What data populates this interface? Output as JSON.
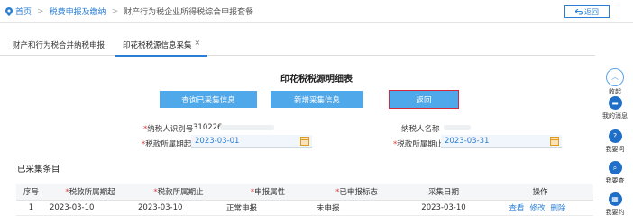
{
  "breadcrumb": {
    "home": "首页",
    "level2": "税费申报及缴纳",
    "current": "财产行为税企业所得税综合申报套餐"
  },
  "header": {
    "back_label": "返回"
  },
  "tabs": [
    {
      "label": "财产和行为税合并纳税申报"
    },
    {
      "label": "印花税税源信息采集",
      "close": "×"
    }
  ],
  "form": {
    "title": "印花税税源明细表",
    "buttons": {
      "query": "查询已采集信息",
      "add": "新增采集信息",
      "return": "返回"
    },
    "taxpayer_id_label": "纳税人识别号",
    "taxpayer_id_value": "310226",
    "taxpayer_name_label": "纳税人名称",
    "period_start_label": "税款所属期起",
    "period_start_value": "2023-03-01",
    "period_end_label": "税款所属期止",
    "period_end_value": "2023-03-31",
    "required_mark": "*"
  },
  "collected": {
    "title": "已采集条目",
    "columns": [
      "序号",
      "*税款所属期起",
      "*税款所属期止",
      "*申报属性",
      "*已申报标志",
      "采集日期",
      "操作"
    ],
    "rows": [
      {
        "index": "1",
        "start": "2023-03-10",
        "end": "2023-03-10",
        "attribute": "正常申报",
        "flag": "未申报",
        "date": "2023-03-10",
        "ops": [
          "查看",
          "修改",
          "删除"
        ]
      }
    ]
  },
  "sidebar": {
    "collapse": "收起",
    "items": [
      {
        "label": "我的消息",
        "icon": "message-icon"
      },
      {
        "label": "我要问",
        "icon": "question-icon"
      },
      {
        "label": "我要查",
        "icon": "search-icon"
      },
      {
        "label": "我要约",
        "icon": "calendar-icon"
      }
    ]
  },
  "colors": {
    "accent": "#2a7fd4",
    "button": "#4fa8ea",
    "required": "#e23b3b",
    "highlight": "#d8263a"
  }
}
